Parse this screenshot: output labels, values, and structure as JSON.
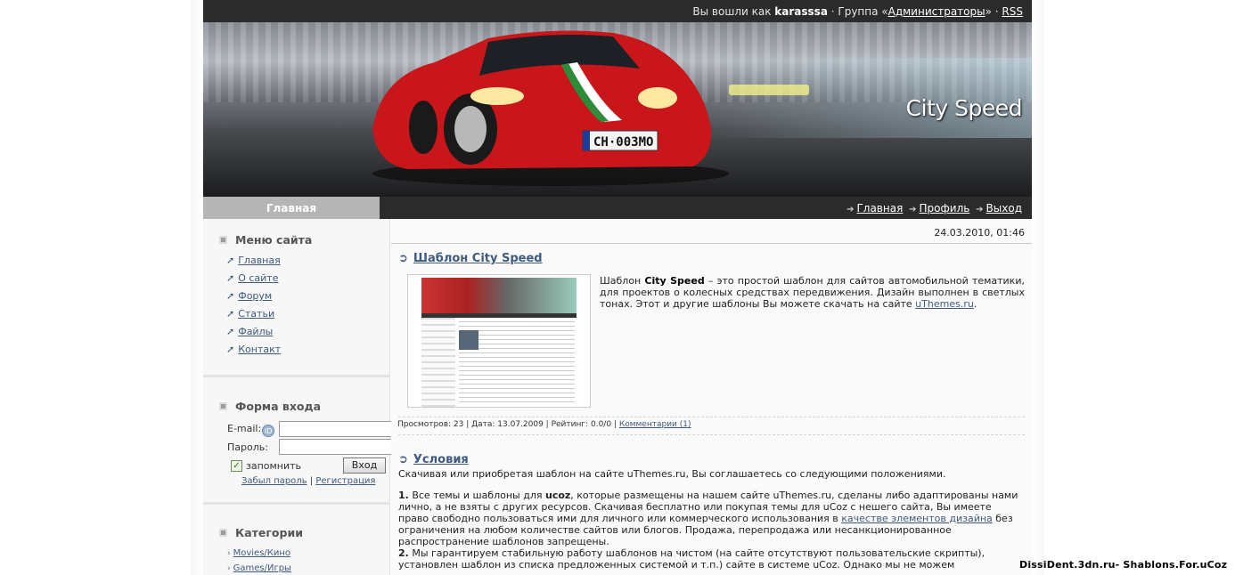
{
  "topbar": {
    "logged_in_prefix": "Вы вошли как",
    "username": "karasssa",
    "group_prefix": "· Группа «",
    "group": "Администраторы",
    "group_suffix": "» ·",
    "rss": "RSS"
  },
  "banner": {
    "site_title": "City Speed"
  },
  "nav": {
    "active_tab": "Главная",
    "links": [
      "Главная",
      "Профиль",
      "Выход"
    ]
  },
  "sidebar": {
    "menu": {
      "title": "Меню сайта",
      "items": [
        "Главная",
        "О сайте",
        "Форум",
        "Статьи",
        "Файлы",
        "Контакт"
      ]
    },
    "login": {
      "title": "Форма входа",
      "email_label": "E-mail:",
      "password_label": "Пароль:",
      "email_value": "",
      "password_value": "",
      "remember_label": "запомнить",
      "remember_checked": true,
      "submit_label": "Вход",
      "forgot_label": "Забыл пароль",
      "divider": "|",
      "register_label": "Регистрация"
    },
    "categories": {
      "title": "Категории",
      "items": [
        "Movies/Кино",
        "Games/Игры"
      ]
    }
  },
  "content": {
    "date": "24.03.2010, 01:46",
    "post1": {
      "title": "Шаблон City Speed",
      "text_a": "Шаблон ",
      "text_bold": "City Speed",
      "text_b": " – это простой шаблон для сайтов автомобильной тематики, для проектов о колесных средствах передвижения. Дизайн выполнен в светлых тонах. Этот и другие шаблоны Вы можете скачать на сайте ",
      "text_link": "uThemes.ru",
      "text_c": ".",
      "meta_text": "Просмотров: 23 | Дата: 13.07.2009 | Рейтинг: 0.0/0 |",
      "meta_link": "Комментарии (1)"
    },
    "post2": {
      "title": "Условия",
      "intro": "Скачивая или приобретая шаблон на сайте uThemes.ru, Вы соглашаетесь со следующими положениями.",
      "p1_num": "1.",
      "p1_a": " Все темы и шаблоны для ",
      "p1_bold": "ucoz",
      "p1_b": ", которые размещены на нашем сайте uThemes.ru, сделаны либо адаптированы нами лично, а не взяты с других ресурсов. Скачивая бесплатно или покупая темы для uCoz с нешего сайта, Вы имеете право свободно пользоваться ими для личного или коммерческого использования в ",
      "p1_link": "качестве элементов дизайна",
      "p1_c": " без ограничения на любом количестве сайтов или блогов. Продажа, перепродажа или несанкционированное распространение шаблонов запрещены.",
      "p2_num": "2.",
      "p2_text": " Мы гарантируем стабильную работу шаблонов на чистом (на сайте отсутствуют пользовательские скрипты), установлен шаблон из списка предложенных системой и т.п.) сайте в системе uCoz. Однако мы не можем"
    }
  },
  "watermark": "DissiDent.3dn.ru- Shablons.For.uCoz"
}
